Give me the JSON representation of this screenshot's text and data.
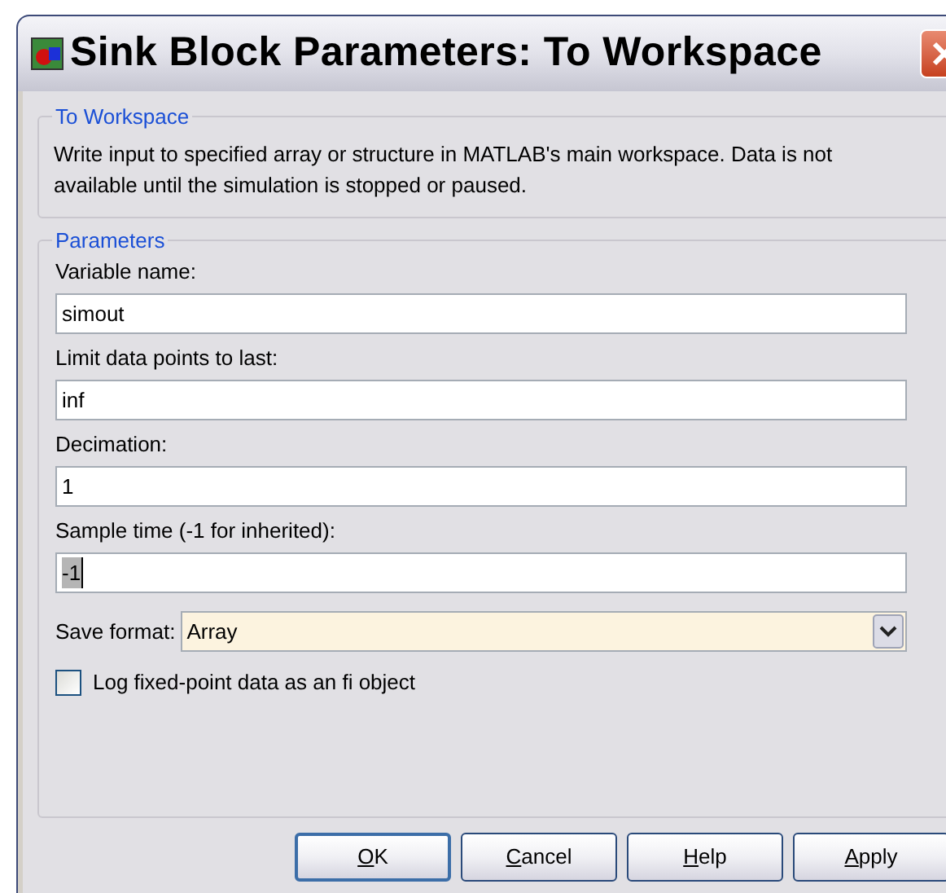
{
  "window": {
    "title": "Sink Block Parameters: To Workspace"
  },
  "description_group": {
    "title": "To Workspace",
    "text": "Write input to specified array or structure in MATLAB's main workspace. Data is not available until the simulation is stopped or paused."
  },
  "parameters_group": {
    "title": "Parameters",
    "fields": [
      {
        "kind": "text",
        "label": "Variable name:",
        "value": "simout",
        "selected_text": false
      },
      {
        "kind": "text",
        "label": "Limit data points to last:",
        "value": "inf",
        "selected_text": false
      },
      {
        "kind": "text",
        "label": "Decimation:",
        "value": "1",
        "selected_text": false
      },
      {
        "kind": "text",
        "label": "Sample time (-1 for inherited):",
        "value": "-1",
        "selected_text": true
      },
      {
        "kind": "select",
        "label": "Save format:",
        "value": "Array"
      },
      {
        "kind": "checkbox",
        "label": "Log fixed-point data as an fi object",
        "checked": false
      }
    ]
  },
  "buttons": [
    {
      "label": "OK",
      "first_letter_underlined": true,
      "default": true
    },
    {
      "label": "Cancel",
      "first_letter_underlined": true,
      "default": false
    },
    {
      "label": "Help",
      "first_letter_underlined": true,
      "default": false
    },
    {
      "label": "Apply",
      "first_letter_underlined": true,
      "default": false
    }
  ]
}
